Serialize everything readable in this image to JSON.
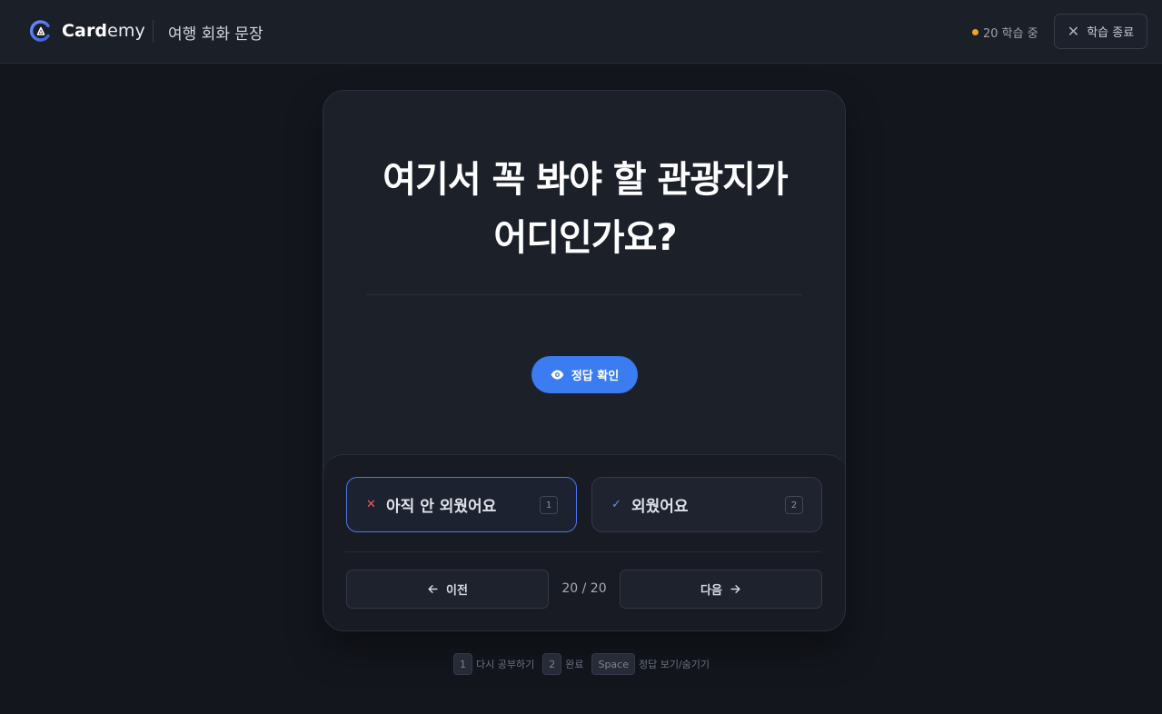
{
  "header": {
    "brand_bold": "Card",
    "brand_rest": "emy",
    "deck_title": "여행 회화 문장",
    "status_text": "20 학습 중",
    "status_color": "#f0a22a",
    "quit_label": "학습 종료",
    "quit_icon": "close-icon"
  },
  "card": {
    "question_line1": "여기서 꼭 봐야 할 관광지가",
    "question_line2": "어디인가요?",
    "reveal_label": "정답 확인",
    "reveal_icon": "eye-icon",
    "accent_color": "#3b7cf0"
  },
  "answers": {
    "not_memorized": {
      "label": "아직 안 외웠어요",
      "key": "1",
      "icon": "x-icon",
      "icon_color": "#ef5b62"
    },
    "memorized": {
      "label": "외웠어요",
      "key": "2",
      "icon": "check-icon",
      "icon_color": "#5a93f5"
    }
  },
  "navigation": {
    "prev_label": "이전",
    "next_label": "다음",
    "counter": "20 / 20"
  },
  "hints": [
    {
      "key": "1",
      "label": "다시 공부하기"
    },
    {
      "key": "2",
      "label": "완료"
    },
    {
      "key": "Space",
      "label": "정답 보기/숨기기"
    }
  ]
}
